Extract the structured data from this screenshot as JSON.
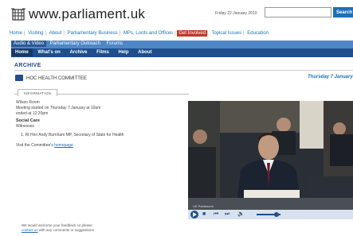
{
  "header": {
    "site_name": "www.parliament.uk",
    "date": "Friday 22 January 2010",
    "search_placeholder": "",
    "search_label": "Search"
  },
  "top_nav": [
    {
      "label": "Home",
      "active": false
    },
    {
      "label": "Visiting",
      "active": false
    },
    {
      "label": "About",
      "active": false
    },
    {
      "label": "Parliamentary Business",
      "active": false
    },
    {
      "label": "MPs, Lords and Offices",
      "active": false
    },
    {
      "label": "Get Involved",
      "active": true
    },
    {
      "label": "Topical Issues",
      "active": false
    },
    {
      "label": "Education",
      "active": false
    }
  ],
  "sub_nav": [
    {
      "label": "Audio & Video",
      "active": true
    },
    {
      "label": "Parliamentary Outreach",
      "active": false
    },
    {
      "label": "Forums",
      "active": false
    }
  ],
  "third_nav": [
    {
      "label": "Home",
      "active": true
    },
    {
      "label": "What's on",
      "active": false
    },
    {
      "label": "Archive",
      "active": false
    },
    {
      "label": "Films",
      "active": false
    },
    {
      "label": "Help",
      "active": false
    },
    {
      "label": "About",
      "active": false
    }
  ],
  "archive_title": "ARCHIVE",
  "committee": "HOC HEALTH COMMITTEE",
  "event_date": "Thursday 7 January",
  "tab_label": "INFORMATION",
  "info": {
    "line1": "Wilson Room",
    "line2": "Meeting started on Thursday 7 January at 10am",
    "line3": "ended at 12:20pm",
    "heading": "Social Care",
    "subheading": "Witnesses",
    "witness": "1. Rt Hon Andy Burnham MP, Secretary of State for Health",
    "visit_prefix": "Visit the Committee's",
    "visit_link": "homepage"
  },
  "feedback": {
    "line1": "We would welcome your feedback so please",
    "link": "contact us",
    "line2_suffix": "with any comments or suggestions"
  },
  "video": {
    "caption": "UK Parliament"
  }
}
